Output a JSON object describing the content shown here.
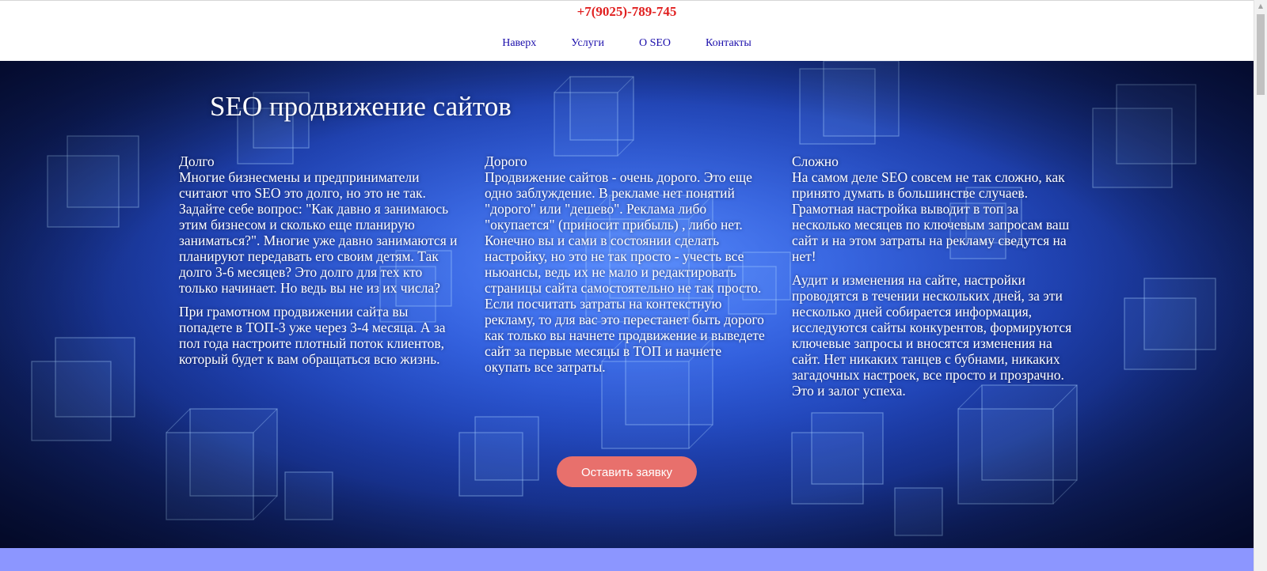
{
  "header": {
    "phone": "+7(9025)-789-745",
    "nav": [
      {
        "label": "Наверх"
      },
      {
        "label": "Услуги"
      },
      {
        "label": "О SEO"
      },
      {
        "label": "Контакты"
      }
    ]
  },
  "hero": {
    "title": "SEO продвижение сайтов",
    "columns": [
      {
        "title": "Долго",
        "paragraphs": [
          "Многие бизнесмены и предприниматели считают что SEO это долго, но это не так. Задайте себе вопрос: \"Как давно я занимаюсь этим бизнесом и сколько еще планирую заниматься?\". Многие уже давно занимаются и планируют передавать его своим детям. Так долго 3-6 месяцев? Это долго для тех кто только начинает. Но ведь вы не из их числа?",
          "При грамотном продвижении сайта вы попадете в ТОП-3 уже через 3-4 месяца. А за пол года настроите плотный поток клиентов, который будет к вам обращаться всю жизнь."
        ]
      },
      {
        "title": "Дорого",
        "paragraphs": [
          "Продвижение сайтов - очень дорого. Это еще одно заблуждение. В рекламе нет понятий \"дорого\" или \"дешево\". Реклама либо \"окупается\" (приносит прибыль) , либо нет. Конечно вы и сами в состоянии сделать настройку, но это не так просто - учесть все ньюансы, ведь их не мало и редактировать страницы сайта самостоятельно не так просто. Если посчитать затраты на контекстную рекламу, то для вас это перестанет быть дорого как только вы начнете продвижение и выведете сайт за первые месяцы в ТОП и начнете окупать все затраты."
        ]
      },
      {
        "title": "Сложно",
        "paragraphs": [
          "На самом деле SEO совсем не так сложно, как принято думать в большинстве случаев. Грамотная настройка выводит в топ за несколько месяцев по ключевым запросам ваш сайт и на этом затраты на рекламу сведутся на нет!",
          "Аудит и изменения на сайте, настройки проводятся в течении нескольких дней, за эти несколько дней собирается информация, исследуются сайты конкурентов, формируются ключевые запросы и вносятся изменения на сайт. Нет никаких танцев с бубнами, никаких загадочных настроек, все просто и прозрачно. Это и залог успеха."
        ]
      }
    ],
    "cta_label": "Оставить заявку"
  },
  "colors": {
    "phone": "#e02020",
    "nav_link": "#1a0dab",
    "cta": "#e8706c",
    "bottom_band": "#8c96ff"
  }
}
